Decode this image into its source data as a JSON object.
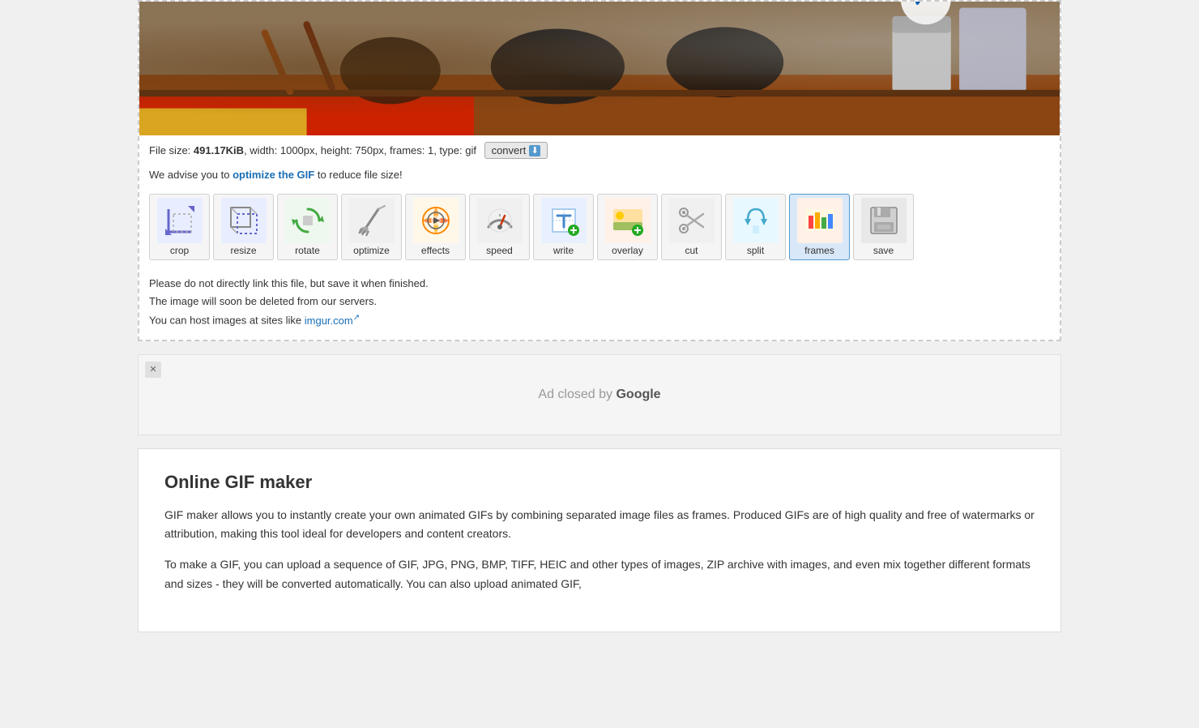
{
  "fileInfo": {
    "prefix": "File size: ",
    "size": "491.17KiB",
    "suffix": ", width: 1000px, height: 750px, frames: 1, type: gif",
    "convertLabel": "convert",
    "downloadSymbol": "⬇"
  },
  "optimizeBar": {
    "prefix": "We advise you to ",
    "linkText": "optimize the GIF",
    "suffix": " to reduce file size!"
  },
  "tools": [
    {
      "id": "crop",
      "label": "crop",
      "iconType": "crop",
      "active": false
    },
    {
      "id": "resize",
      "label": "resize",
      "iconType": "resize",
      "active": false
    },
    {
      "id": "rotate",
      "label": "rotate",
      "iconType": "rotate",
      "active": false
    },
    {
      "id": "optimize",
      "label": "optimize",
      "iconType": "optimize",
      "active": false
    },
    {
      "id": "effects",
      "label": "effects",
      "iconType": "effects",
      "active": false
    },
    {
      "id": "speed",
      "label": "speed",
      "iconType": "speed",
      "active": false
    },
    {
      "id": "write",
      "label": "write",
      "iconType": "write",
      "active": false
    },
    {
      "id": "overlay",
      "label": "overlay",
      "iconType": "overlay",
      "active": false
    },
    {
      "id": "cut",
      "label": "cut",
      "iconType": "cut",
      "active": false
    },
    {
      "id": "split",
      "label": "split",
      "iconType": "split",
      "active": false
    },
    {
      "id": "frames",
      "label": "frames",
      "iconType": "frames",
      "active": true
    },
    {
      "id": "save",
      "label": "save",
      "iconType": "save",
      "active": false
    }
  ],
  "notice": {
    "line1": "Please do not directly link this file, but save it when finished.",
    "line2": "The image will soon be deleted from our servers.",
    "line3prefix": "You can host images at sites like ",
    "line3link": "imgur.com",
    "line3linkSymbol": "↗"
  },
  "ad": {
    "closedText": "Ad closed by ",
    "googleText": "Google"
  },
  "gifMaker": {
    "title": "Online GIF maker",
    "paragraph1": "GIF maker allows you to instantly create your own animated GIFs by combining separated image files as frames. Produced GIFs are of high quality and free of watermarks or attribution, making this tool ideal for developers and content creators.",
    "paragraph2": "To make a GIF, you can upload a sequence of GIF, JPG, PNG, BMP, TIFF, HEIC and other types of images, ZIP archive with images, and even mix together different formats and sizes - they will be converted automatically. You can also upload animated GIF,"
  }
}
